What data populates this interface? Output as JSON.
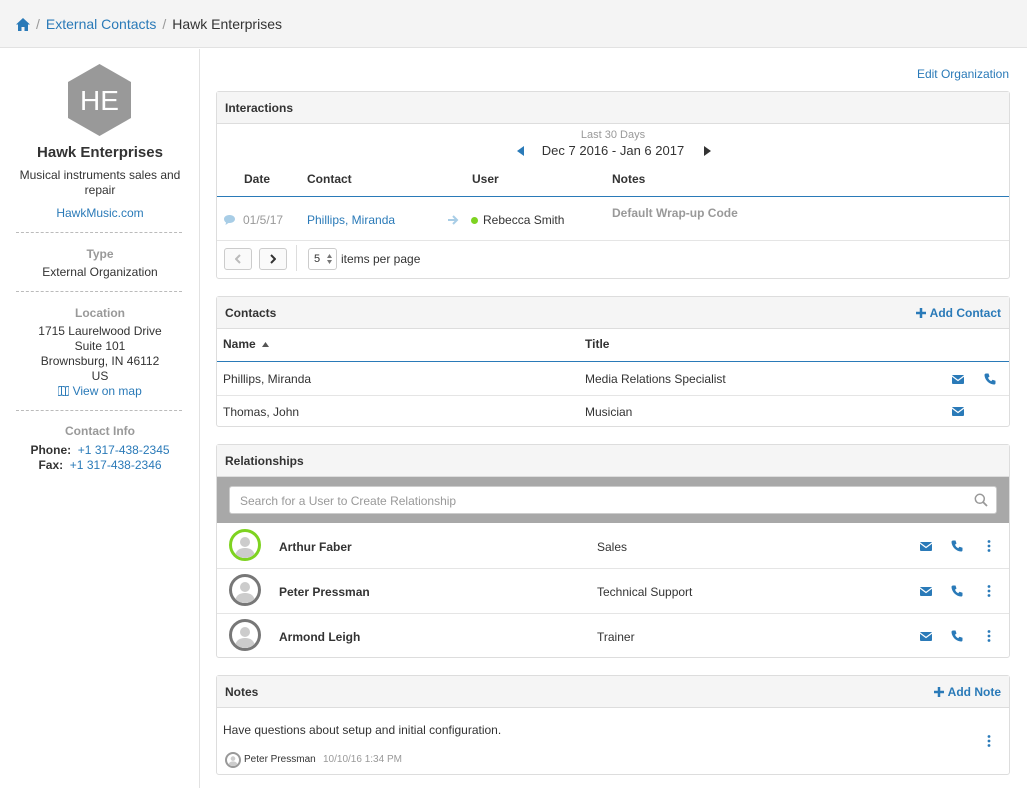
{
  "breadcrumb": {
    "items": [
      "External Contacts",
      "Hawk Enterprises"
    ]
  },
  "sidebar": {
    "logo_initials": "HE",
    "name": "Hawk Enterprises",
    "description": "Musical instruments sales and repair",
    "website": "HawkMusic.com",
    "type_label": "Type",
    "type_value": "External Organization",
    "location_label": "Location",
    "address": [
      "1715 Laurelwood Drive",
      "Suite 101",
      "Brownsburg, IN  46112",
      "US"
    ],
    "view_map": "View on map",
    "contact_label": "Contact Info",
    "phone_label": "Phone:",
    "phone": "+1 317-438-2345",
    "fax_label": "Fax:",
    "fax": "+1 317-438-2346"
  },
  "edit_org": "Edit Organization",
  "interactions": {
    "title": "Interactions",
    "range_label": "Last 30 Days",
    "range": "Dec 7 2016 - Jan 6 2017",
    "headers": {
      "date": "Date",
      "contact": "Contact",
      "user": "User",
      "notes": "Notes"
    },
    "rows": [
      {
        "date": "01/5/17",
        "contact": "Phillips, Miranda",
        "user": "Rebecca Smith",
        "notes": "Default Wrap-up Code"
      }
    ],
    "per_page": "5",
    "per_page_label": "items per page"
  },
  "contacts": {
    "title": "Contacts",
    "add": "Add Contact",
    "headers": {
      "name": "Name",
      "title": "Title"
    },
    "rows": [
      {
        "name": "Phillips, Miranda",
        "title": "Media Relations Specialist"
      },
      {
        "name": "Thomas, John",
        "title": "Musician"
      }
    ]
  },
  "relationships": {
    "title": "Relationships",
    "search_placeholder": "Search for a User to Create Relationship",
    "rows": [
      {
        "name": "Arthur Faber",
        "dept": "Sales"
      },
      {
        "name": "Peter Pressman",
        "dept": "Technical Support"
      },
      {
        "name": "Armond Leigh",
        "dept": "Trainer"
      }
    ]
  },
  "notes": {
    "title": "Notes",
    "add": "Add Note",
    "text": "Have questions about setup and initial configuration.",
    "author": "Peter Pressman",
    "time": "10/10/16 1:34 PM"
  },
  "colors": {
    "accent": "#2a7ab8",
    "online": "#7ed321",
    "hex_logo": "#999999"
  }
}
